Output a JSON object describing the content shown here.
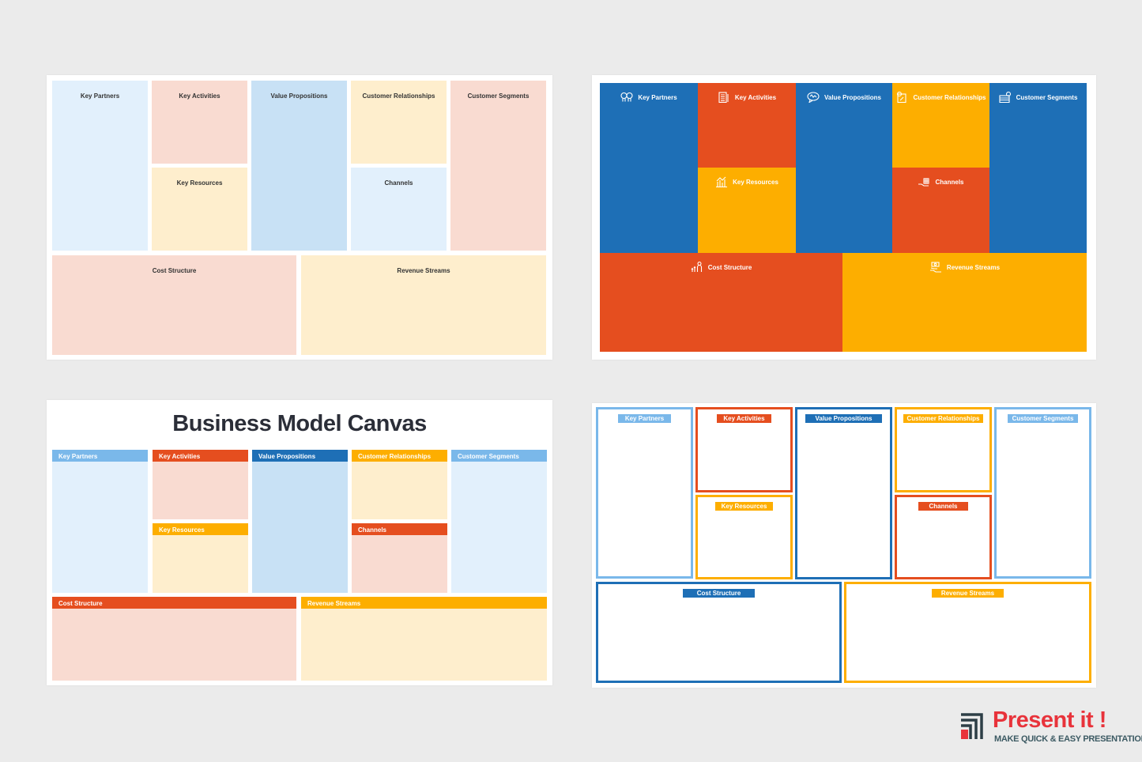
{
  "colors": {
    "blue": "#1e6fb6",
    "light_blue": "#7ab8ea",
    "red_orange": "#e54e1f",
    "amber": "#fdae00",
    "pale_blue": "#e2f0fc",
    "soft_blue": "#c8e1f5",
    "pale_red": "#f9dbd1",
    "pale_yellow": "#feeecd",
    "title_dark": "#2b2e38",
    "logo_red": "#e8333b",
    "logo_teal": "#3c5a63"
  },
  "blocks": {
    "key_partners": "Key Partners",
    "key_activities": "Key Activities",
    "key_resources": "Key Resources",
    "value_propositions": "Value Propositions",
    "customer_relationships": "Customer Relationships",
    "channels": "Channels",
    "customer_segments": "Customer Segments",
    "cost_structure": "Cost Structure",
    "revenue_streams": "Revenue Streams"
  },
  "slide3": {
    "title": "Business Model Canvas"
  },
  "slide2_icons": {
    "key_partners": "partners-heads-icon",
    "key_activities": "clipboard-list-icon",
    "value_propositions": "speech-bubble-icon",
    "customer_relationships": "handshake-document-icon",
    "customer_segments": "wallet-check-icon",
    "key_resources": "chart-bars-icon",
    "channels": "hand-delivery-icon",
    "cost_structure": "person-growth-icon",
    "revenue_streams": "money-hand-icon"
  },
  "logo": {
    "name": "Present it !",
    "tagline": "MAKE QUICK & EASY PRESENTATIONS"
  }
}
